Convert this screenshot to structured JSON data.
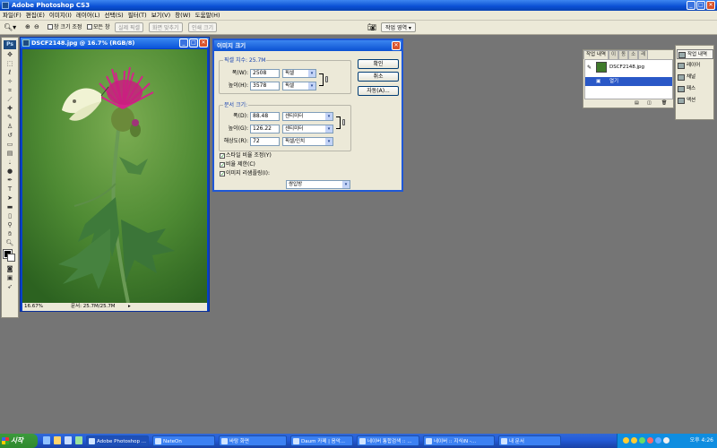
{
  "app": {
    "title": "Adobe Photoshop CS3"
  },
  "menu": [
    "파일(F)",
    "편집(E)",
    "이미지(I)",
    "레이어(L)",
    "선택(S)",
    "필터(T)",
    "보기(V)",
    "창(W)",
    "도움말(H)"
  ],
  "options": {
    "resize_windows": "창 크기 조정",
    "all_windows": "모든 창",
    "actual_pixels": "실제 픽셀",
    "fit_screen": "화면 맞추기",
    "print_size": "인쇄 크기",
    "workspace": "작업 영역"
  },
  "document": {
    "title": "DSCF2148.jpg @ 16.7% (RGB/8)",
    "zoom": "16.67%",
    "doc_info": "문서: 25.7M/25.7M"
  },
  "dialog": {
    "title": "이미지 크기",
    "pixel_dimensions": "픽셀 치수: 25.7M",
    "width_label": "폭(W):",
    "width_value": "2508",
    "width_unit": "픽셀",
    "height_label": "높이(H):",
    "height_value": "3578",
    "height_unit": "픽셀",
    "document_size": "문서 크기:",
    "doc_width_label": "폭(D):",
    "doc_width_value": "88.48",
    "doc_width_unit": "센티미터",
    "doc_height_label": "높이(G):",
    "doc_height_value": "126.22",
    "doc_height_unit": "센티미터",
    "resolution_label": "해상도(R):",
    "resolution_value": "72",
    "resolution_unit": "픽셀/인치",
    "scale_styles": "스타일 비율 조정(Y)",
    "constrain": "비율 제한(C)",
    "resample": "이미지 리샘플링(I):",
    "resample_method": "쌍입방",
    "ok": "확인",
    "cancel": "취소",
    "auto": "자동(A)..."
  },
  "history": {
    "tabs": [
      "작업 내역",
      "이",
      "동",
      "소",
      "레"
    ],
    "snapshot": "DSCF2148.jpg",
    "step": "열기"
  },
  "dock": [
    "작업 내역",
    "레이어",
    "채널",
    "패스",
    "액션"
  ],
  "taskbar": {
    "start": "시작",
    "items": [
      "Adobe Photoshop ...",
      "NateOn",
      "바탕 화면",
      "Daum 카페 | 음악...",
      "네이버 통합검색 :: ...",
      "네이버 :: 지식iN -...",
      "내 문서"
    ],
    "clock": "오후 4:26"
  }
}
